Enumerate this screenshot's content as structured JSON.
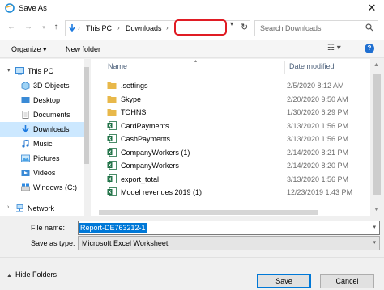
{
  "window": {
    "title": "Save As",
    "close_icon": "close-icon"
  },
  "address": {
    "crumbs": [
      "This PC",
      "Downloads"
    ],
    "search_placeholder": "Search Downloads"
  },
  "toolbar": {
    "organize_label": "Organize ▾",
    "new_folder_label": "New folder",
    "help_label": "?"
  },
  "nav": {
    "items": [
      {
        "label": "This PC",
        "icon": "computer-icon"
      },
      {
        "label": "3D Objects",
        "icon": "3d-objects-icon"
      },
      {
        "label": "Desktop",
        "icon": "desktop-icon"
      },
      {
        "label": "Documents",
        "icon": "documents-icon"
      },
      {
        "label": "Downloads",
        "icon": "downloads-icon",
        "selected": true
      },
      {
        "label": "Music",
        "icon": "music-icon"
      },
      {
        "label": "Pictures",
        "icon": "pictures-icon"
      },
      {
        "label": "Videos",
        "icon": "videos-icon"
      },
      {
        "label": "Windows (C:)",
        "icon": "drive-icon"
      },
      {
        "label": "Network",
        "icon": "network-icon"
      }
    ]
  },
  "filelist": {
    "columns": {
      "name": "Name",
      "date": "Date modified"
    },
    "rows": [
      {
        "name": ".settings",
        "date": "2/5/2020 8:12 AM",
        "type": "folder"
      },
      {
        "name": "Skype",
        "date": "2/20/2020 9:50 AM",
        "type": "folder"
      },
      {
        "name": "TOHNS",
        "date": "1/30/2020 6:29 PM",
        "type": "folder"
      },
      {
        "name": "CardPayments",
        "date": "3/13/2020 1:56 PM",
        "type": "excel"
      },
      {
        "name": "CashPayments",
        "date": "3/13/2020 1:56 PM",
        "type": "excel"
      },
      {
        "name": "CompanyWorkers (1)",
        "date": "2/14/2020 8:21 PM",
        "type": "excel"
      },
      {
        "name": "CompanyWorkers",
        "date": "2/14/2020 8:20 PM",
        "type": "excel"
      },
      {
        "name": "export_total",
        "date": "3/13/2020 1:56 PM",
        "type": "excel"
      },
      {
        "name": "Model revenues 2019 (1)",
        "date": "12/23/2019 1:43 PM",
        "type": "excel"
      }
    ]
  },
  "form": {
    "filename_label": "File name:",
    "filename_value": "Report-DE763212-1",
    "savetype_label": "Save as type:",
    "savetype_value": "Microsoft Excel Worksheet"
  },
  "footer": {
    "hide_folders_label": "Hide Folders",
    "save_label": "Save",
    "cancel_label": "Cancel"
  },
  "colors": {
    "accent": "#0078d7",
    "highlight_border": "#e01c24",
    "selected_nav": "#cce8ff",
    "folder": "#e8b84a",
    "excel": "#1d7044"
  }
}
